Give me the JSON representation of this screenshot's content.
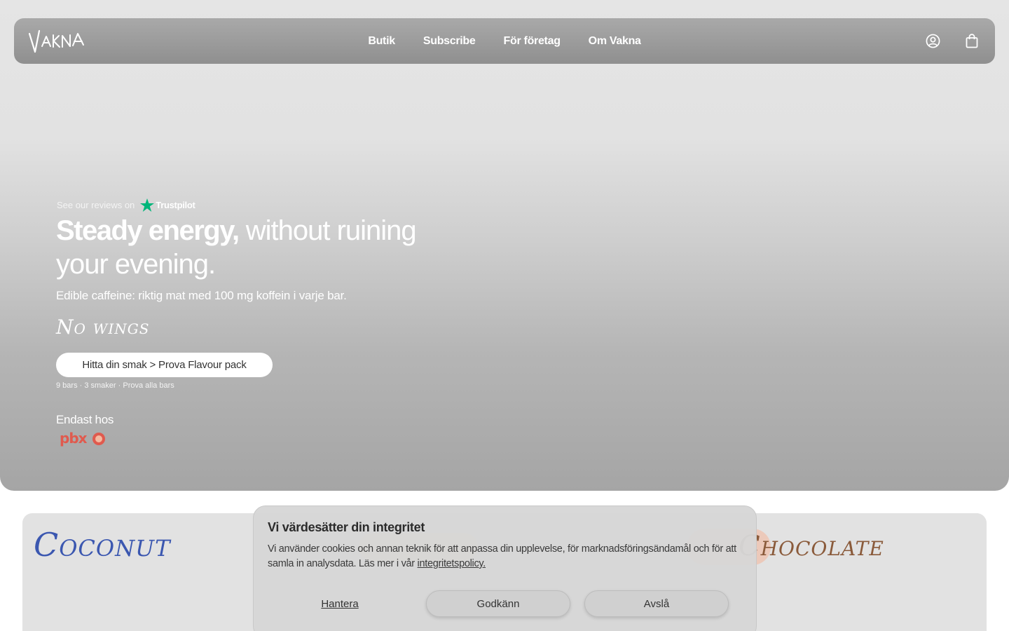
{
  "brand": {
    "logo_text": "Vakna"
  },
  "nav": {
    "items": [
      "Butik",
      "Subscribe",
      "För företag",
      "Om Vakna"
    ]
  },
  "header_icons": [
    "account-icon",
    "cart-icon"
  ],
  "hero": {
    "reviews_prefix": "See our reviews on",
    "trustpilot": "Trustpilot",
    "headline_bold": "Steady energy,",
    "headline_rest": " without ruining your evening.",
    "subline": "Edible caffeine: riktig mat med 100 mg koffein i varje bar.",
    "script": "No wings",
    "cta": "Hitta din smak > Prova Flavour pack",
    "cta_meta": "9 bars · 3 smaker · Prova alla bars",
    "only_at": "Endast hos",
    "retailer": "pbxo"
  },
  "cards": {
    "coconut": "Coconut",
    "chocolate": "Chocolate"
  },
  "cookie": {
    "title": "Vi värdesätter din integritet",
    "text": "Vi använder cookies och annan teknik för att anpassa din upplevelse, för marknadsföringsändamål och för att samla in analysdata. Läs mer i vår ",
    "policy_link": "integritetspolicy.",
    "manage": "Hantera",
    "accept": "Godkänn",
    "reject": "Avslå"
  },
  "colors": {
    "trustpilot_green": "#00b67a",
    "coconut_blue": "#3b57b0",
    "chocolate_brown": "#8a5a3a",
    "pbx_red": "#e05a4e"
  }
}
